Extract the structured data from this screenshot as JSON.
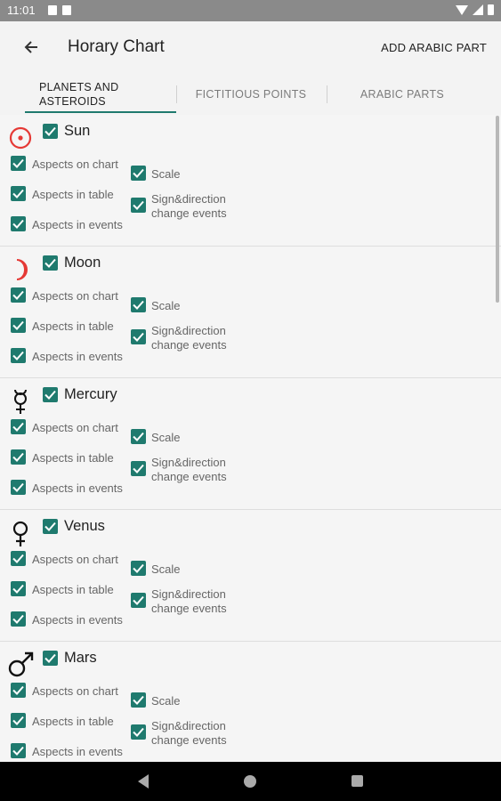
{
  "status": {
    "time": "11:01"
  },
  "appbar": {
    "title": "Horary Chart",
    "action": "ADD ARABIC PART"
  },
  "tabs": [
    {
      "label": "PLANETS AND ASTEROIDS",
      "active": true
    },
    {
      "label": "FICTITIOUS POINTS",
      "active": false
    },
    {
      "label": "ARABIC PARTS",
      "active": false
    }
  ],
  "colors": {
    "accent": "#1f7a6e",
    "sun_moon": "#e53935"
  },
  "planets": [
    {
      "name": "Sun",
      "icon": "sun-icon"
    },
    {
      "name": "Moon",
      "icon": "moon-icon"
    },
    {
      "name": "Mercury",
      "icon": "mercury-icon"
    },
    {
      "name": "Venus",
      "icon": "venus-icon"
    },
    {
      "name": "Mars",
      "icon": "mars-icon"
    }
  ],
  "options": {
    "aspects_on_chart": "Aspects on chart",
    "aspects_in_table": "Aspects in table",
    "aspects_in_events": "Aspects in events",
    "scale": "Scale",
    "sign_direction_1": "Sign&direction",
    "sign_direction_2": "change events"
  }
}
